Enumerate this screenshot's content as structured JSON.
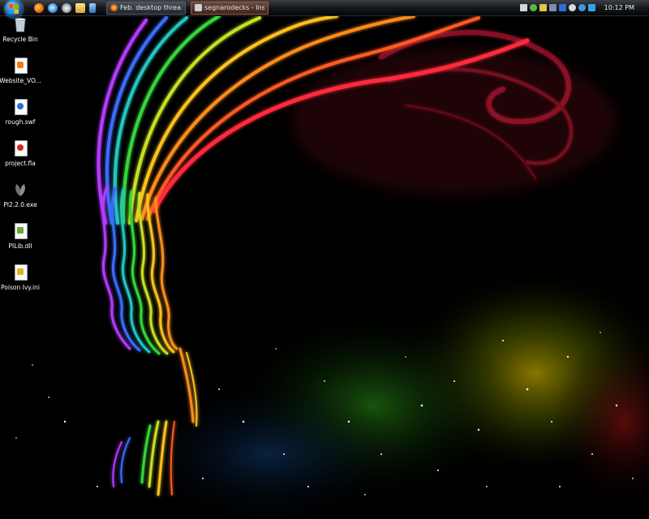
{
  "taskbar": {
    "start_label": "Start",
    "quick_launch": [
      "firefox-icon",
      "internet-explorer-icon",
      "application-icon",
      "folder-icon",
      "media-icon"
    ],
    "tasks": [
      {
        "label": "Feb. desktop threa...",
        "icon": "firefox-icon",
        "active": false
      },
      {
        "label": "segnarodecks - Inst...",
        "icon": "instant-messenger-icon",
        "active": true
      }
    ],
    "tray_icons": [
      "network-icon",
      "sync-icon",
      "security-icon",
      "display-icon",
      "messenger-icon",
      "volume-icon",
      "globe-icon",
      "chat-icon"
    ],
    "clock": "10:12 PM"
  },
  "desktop": {
    "icons": [
      {
        "label": "Recycle Bin",
        "icon": "recycle-bin-icon"
      },
      {
        "label": "Website_VO...",
        "icon": "html-file-icon"
      },
      {
        "label": "rough.swf",
        "icon": "swf-file-icon"
      },
      {
        "label": "project.fla",
        "icon": "fla-file-icon"
      },
      {
        "label": "PI2.2.0.exe",
        "icon": "leaf-exe-icon"
      },
      {
        "label": "PILib.dll",
        "icon": "dll-file-icon"
      },
      {
        "label": "Poison Ivy.ini",
        "icon": "ini-file-icon"
      }
    ]
  },
  "colors": {
    "background": "#000000",
    "accent_active_task": "#b0582a"
  }
}
